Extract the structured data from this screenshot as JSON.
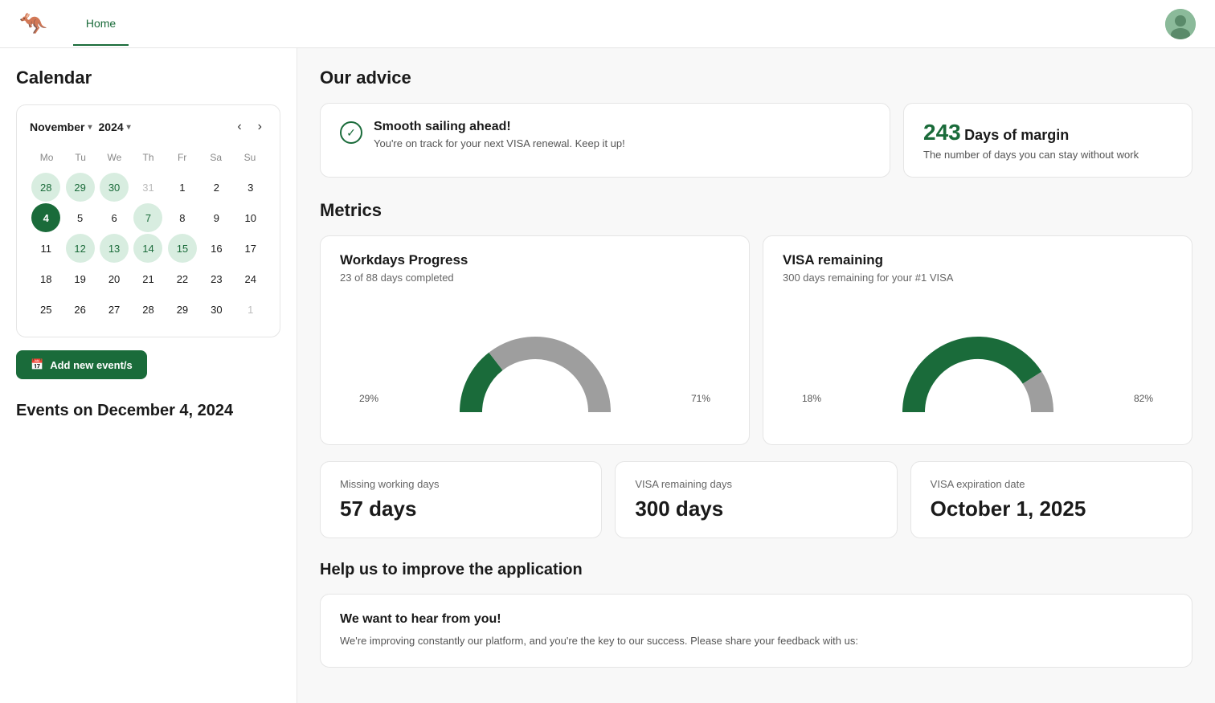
{
  "navbar": {
    "logo_icon": "🦘",
    "home_label": "Home",
    "avatar_emoji": "🧑"
  },
  "calendar": {
    "title": "Calendar",
    "month": "November",
    "year": "2024",
    "weekdays": [
      "Mo",
      "Tu",
      "We",
      "Th",
      "Fr",
      "Sa",
      "Su"
    ],
    "add_event_label": "Add new event/s",
    "events_title": "Events on December 4, 2024",
    "days": [
      {
        "label": "28",
        "type": "other-month highlighted"
      },
      {
        "label": "29",
        "type": "other-month highlighted"
      },
      {
        "label": "30",
        "type": "other-month highlighted"
      },
      {
        "label": "31",
        "type": "other-month"
      },
      {
        "label": "1",
        "type": ""
      },
      {
        "label": "2",
        "type": ""
      },
      {
        "label": "3",
        "type": ""
      },
      {
        "label": "4",
        "type": "selected"
      },
      {
        "label": "5",
        "type": ""
      },
      {
        "label": "6",
        "type": ""
      },
      {
        "label": "7",
        "type": "highlighted"
      },
      {
        "label": "8",
        "type": ""
      },
      {
        "label": "9",
        "type": ""
      },
      {
        "label": "10",
        "type": ""
      },
      {
        "label": "11",
        "type": ""
      },
      {
        "label": "12",
        "type": "highlighted"
      },
      {
        "label": "13",
        "type": "highlighted"
      },
      {
        "label": "14",
        "type": "highlighted"
      },
      {
        "label": "15",
        "type": "highlighted"
      },
      {
        "label": "16",
        "type": ""
      },
      {
        "label": "17",
        "type": ""
      },
      {
        "label": "18",
        "type": ""
      },
      {
        "label": "19",
        "type": ""
      },
      {
        "label": "20",
        "type": ""
      },
      {
        "label": "21",
        "type": ""
      },
      {
        "label": "22",
        "type": ""
      },
      {
        "label": "23",
        "type": ""
      },
      {
        "label": "24",
        "type": ""
      },
      {
        "label": "25",
        "type": ""
      },
      {
        "label": "26",
        "type": ""
      },
      {
        "label": "27",
        "type": ""
      },
      {
        "label": "28",
        "type": ""
      },
      {
        "label": "29",
        "type": ""
      },
      {
        "label": "30",
        "type": ""
      },
      {
        "label": "1",
        "type": "other-month"
      }
    ]
  },
  "advice": {
    "section_title": "Our advice",
    "smooth_title": "Smooth sailing ahead!",
    "smooth_desc": "You're on track for your next VISA renewal. Keep it up!",
    "margin_number": "243",
    "margin_label": "Days of margin",
    "margin_desc": "The number of days you can stay without work"
  },
  "metrics": {
    "section_title": "Metrics",
    "workdays": {
      "title": "Workdays Progress",
      "subtitle": "23 of 88 days completed",
      "green_pct": 29,
      "gray_pct": 71,
      "green_label": "29%",
      "gray_label": "71%"
    },
    "visa": {
      "title": "VISA remaining",
      "subtitle": "300 days remaining for your #1 VISA",
      "green_pct": 82,
      "gray_pct": 18,
      "green_label": "82%",
      "gray_label": "18%"
    }
  },
  "stats": {
    "missing_label": "Missing working days",
    "missing_value": "57 days",
    "remaining_label": "VISA remaining days",
    "remaining_value": "300 days",
    "expiration_label": "VISA expiration date",
    "expiration_value": "October 1, 2025"
  },
  "feedback": {
    "section_title": "Help us to improve the application",
    "card_title": "We want to hear from you!",
    "card_desc": "We're improving constantly our platform, and you're the key to our success. Please share your feedback with us:"
  }
}
